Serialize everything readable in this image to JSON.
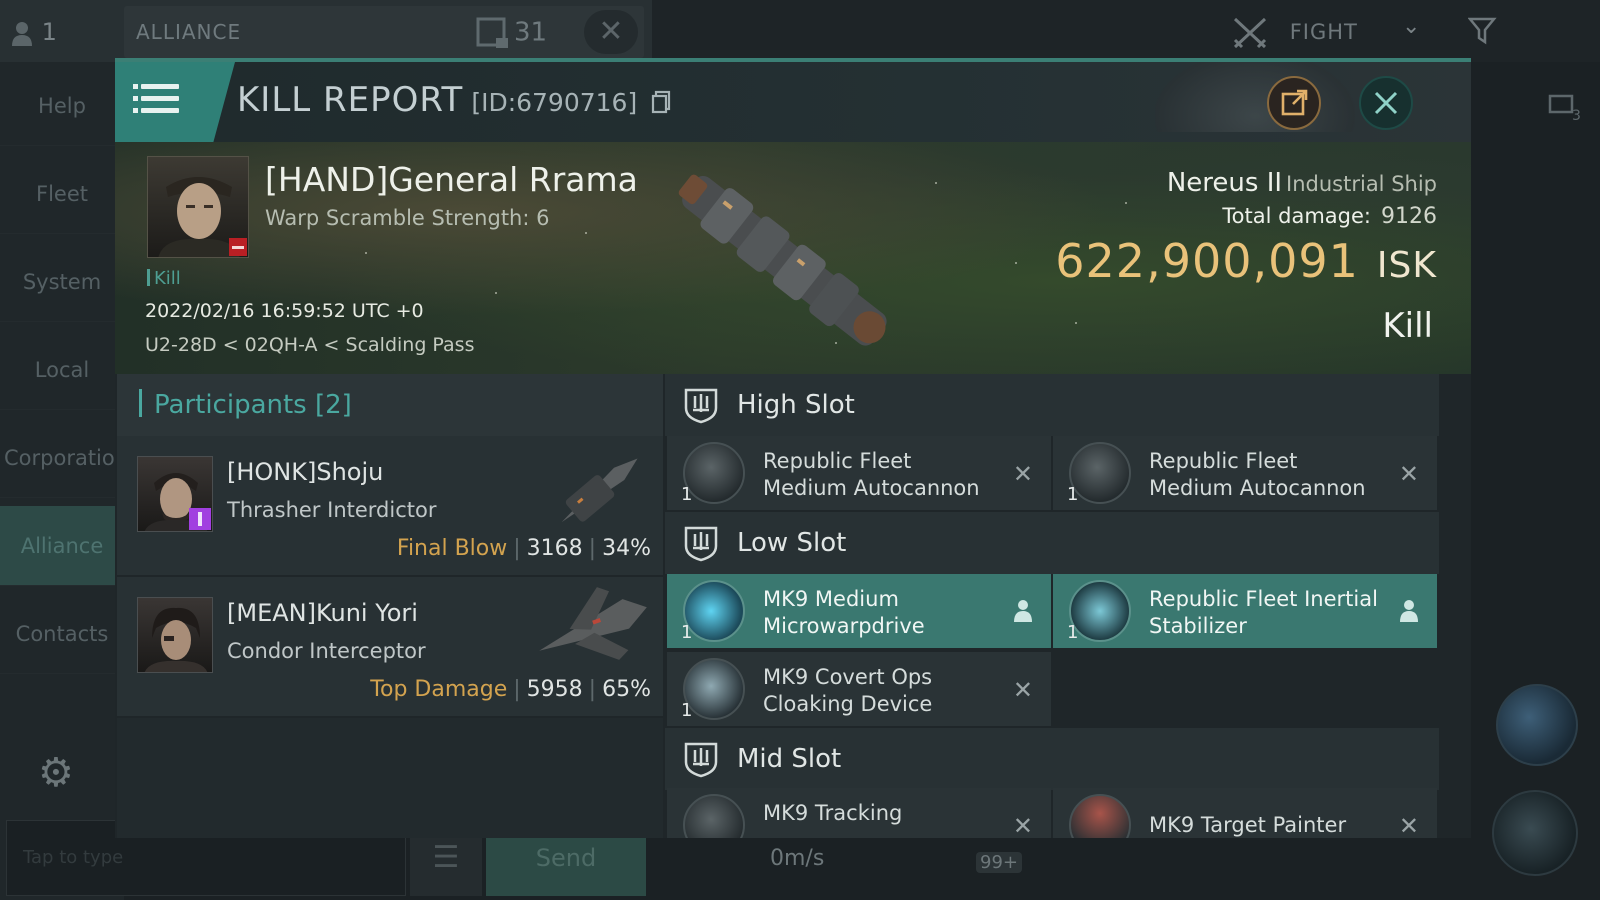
{
  "background": {
    "online_count": "1",
    "channel_name": "ALLIANCE",
    "member_count": "31",
    "fight_label": "FIGHT",
    "sidebar_items": [
      "Help",
      "Fleet",
      "System",
      "Local",
      "Corporation",
      "Alliance",
      "Contacts"
    ],
    "chat_placeholder": "Tap to type",
    "send_label": "Send",
    "speed": "0m/s",
    "notification_badge": "99+",
    "right_icon_count": "3"
  },
  "dialog": {
    "title": "KILL REPORT",
    "report_id": "[ID:6790716]"
  },
  "victim": {
    "name": "[HAND]General Rrama",
    "warp_scramble": "Warp Scramble Strength: 6",
    "tag": "Kill",
    "timestamp": "2022/02/16 16:59:52 UTC +0",
    "location": "U2-28D < 02QH-A < Scalding Pass",
    "ship_name": "Nereus II",
    "ship_class": "Industrial Ship",
    "total_damage_label": "Total damage:",
    "total_damage": "9126",
    "isk_value": "622,900,091",
    "isk_unit": "ISK",
    "result": "Kill"
  },
  "participants": {
    "header": "Participants [2]",
    "list": [
      {
        "name": "[HONK]Shoju",
        "ship": "Thrasher Interdictor",
        "role": "Final Blow",
        "damage": "3168",
        "percent": "34%"
      },
      {
        "name": "[MEAN]Kuni Yori",
        "ship": "Condor Interceptor",
        "role": "Top Damage",
        "damage": "5958",
        "percent": "65%"
      }
    ]
  },
  "fitting": {
    "high_slot": {
      "title": "High Slot",
      "modules": [
        {
          "qty": "1",
          "name": "Republic Fleet Medium Autocannon",
          "status": "dropped"
        },
        {
          "qty": "1",
          "name": "Republic Fleet Medium Autocannon",
          "status": "dropped"
        }
      ]
    },
    "low_slot": {
      "title": "Low Slot",
      "modules": [
        {
          "qty": "1",
          "name": "MK9 Medium Microwarpdrive",
          "status": "looted"
        },
        {
          "qty": "1",
          "name": "Republic Fleet Inertial Stabilizer",
          "status": "looted"
        },
        {
          "qty": "1",
          "name": "MK9 Covert Ops Cloaking Device",
          "status": "dropped"
        }
      ]
    },
    "mid_slot": {
      "title": "Mid Slot",
      "modules": [
        {
          "qty": "",
          "name": "MK9 Tracking",
          "status": "dropped"
        },
        {
          "qty": "",
          "name": "MK9 Target Painter",
          "status": "dropped"
        }
      ]
    }
  },
  "colors": {
    "accent_teal": "#2f8077",
    "isk_gold": "#e9c27a",
    "final_blow_orange": "#d3a34f",
    "highlight_module": "#3a7870"
  }
}
